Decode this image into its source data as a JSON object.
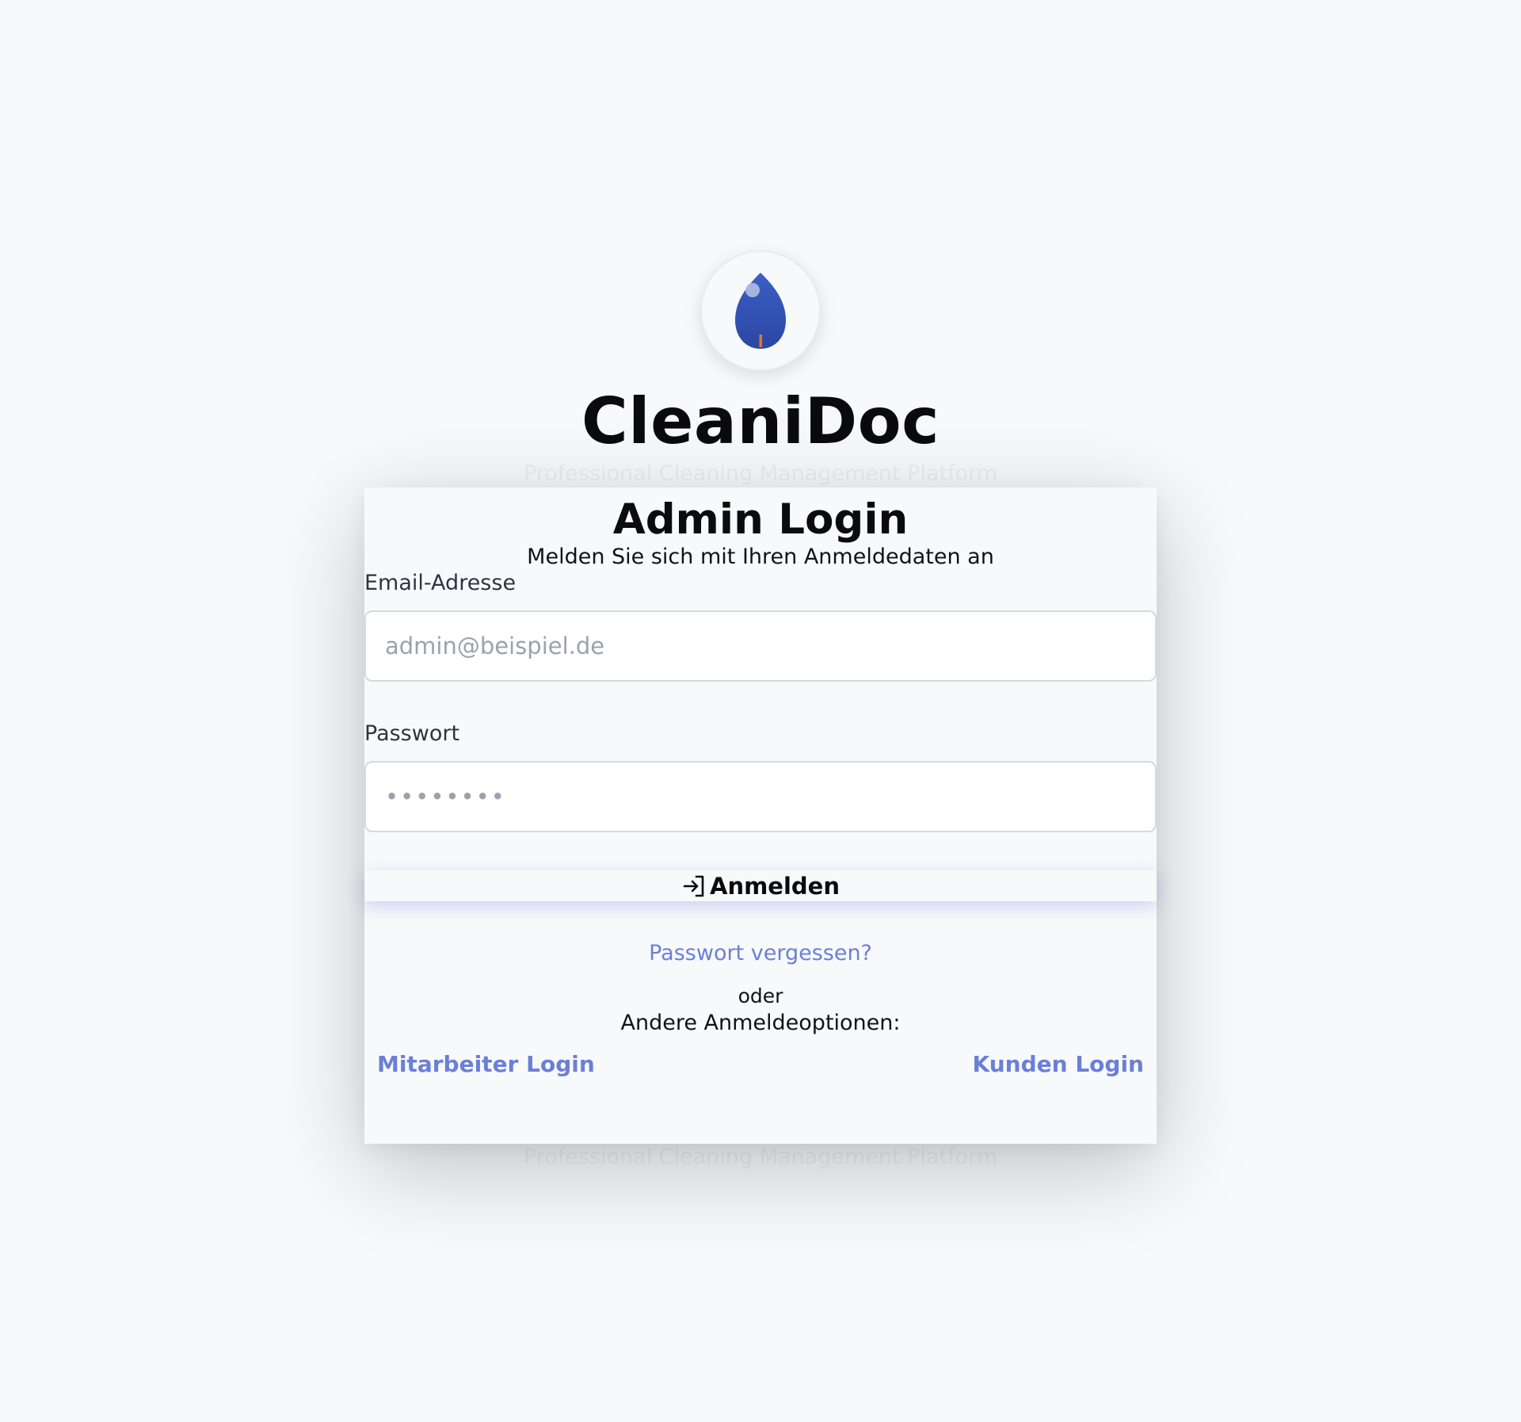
{
  "brand": {
    "name": "CleaniDoc",
    "tagline": "Professional Cleaning Management Platform",
    "footer_tagline": "Professional Cleaning Management Platform"
  },
  "login_card": {
    "title": "Admin Login",
    "subtitle": "Melden Sie sich mit Ihren Anmeldedaten an",
    "email": {
      "label": "Email-Adresse",
      "placeholder": "admin@beispiel.de",
      "value": ""
    },
    "password": {
      "label": "Passwort",
      "placeholder": "••••••••",
      "value": ""
    },
    "submit_label": "Anmelden",
    "forgot_password": "Passwort vergessen?",
    "divider_text": "oder",
    "other_options_label": "Andere Anmeldeoptionen:",
    "employee_login": "Mitarbeiter Login",
    "customer_login": "Kunden Login"
  },
  "icons": {
    "logo": "water-drop-icon",
    "submit": "login-arrow-icon"
  },
  "colors": {
    "background": "#f8f9fb",
    "logo_drop": "#3050b0",
    "logo_accent": "#e07a1f",
    "link": "#6b7fd6",
    "heading": "#0b0b0f"
  }
}
